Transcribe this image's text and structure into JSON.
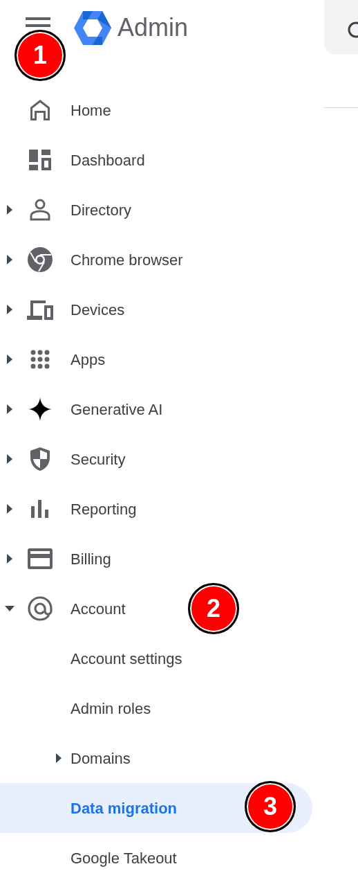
{
  "header": {
    "title": "Admin",
    "callout": "1"
  },
  "nav": [
    {
      "label": "Home",
      "expandable": false
    },
    {
      "label": "Dashboard",
      "expandable": false
    },
    {
      "label": "Directory",
      "expandable": true,
      "expanded": false
    },
    {
      "label": "Chrome browser",
      "expandable": true,
      "expanded": false
    },
    {
      "label": "Devices",
      "expandable": true,
      "expanded": false
    },
    {
      "label": "Apps",
      "expandable": true,
      "expanded": false
    },
    {
      "label": "Generative AI",
      "expandable": true,
      "expanded": false
    },
    {
      "label": "Security",
      "expandable": true,
      "expanded": false
    },
    {
      "label": "Reporting",
      "expandable": true,
      "expanded": false
    },
    {
      "label": "Billing",
      "expandable": true,
      "expanded": false
    },
    {
      "label": "Account",
      "expandable": true,
      "expanded": true,
      "callout": "2",
      "children": [
        {
          "label": "Account settings",
          "expandable": false,
          "selected": false
        },
        {
          "label": "Admin roles",
          "expandable": false,
          "selected": false
        },
        {
          "label": "Domains",
          "expandable": true,
          "selected": false
        },
        {
          "label": "Data migration",
          "expandable": false,
          "selected": true,
          "callout": "3"
        },
        {
          "label": "Google Takeout",
          "expandable": false,
          "selected": false
        }
      ]
    }
  ]
}
